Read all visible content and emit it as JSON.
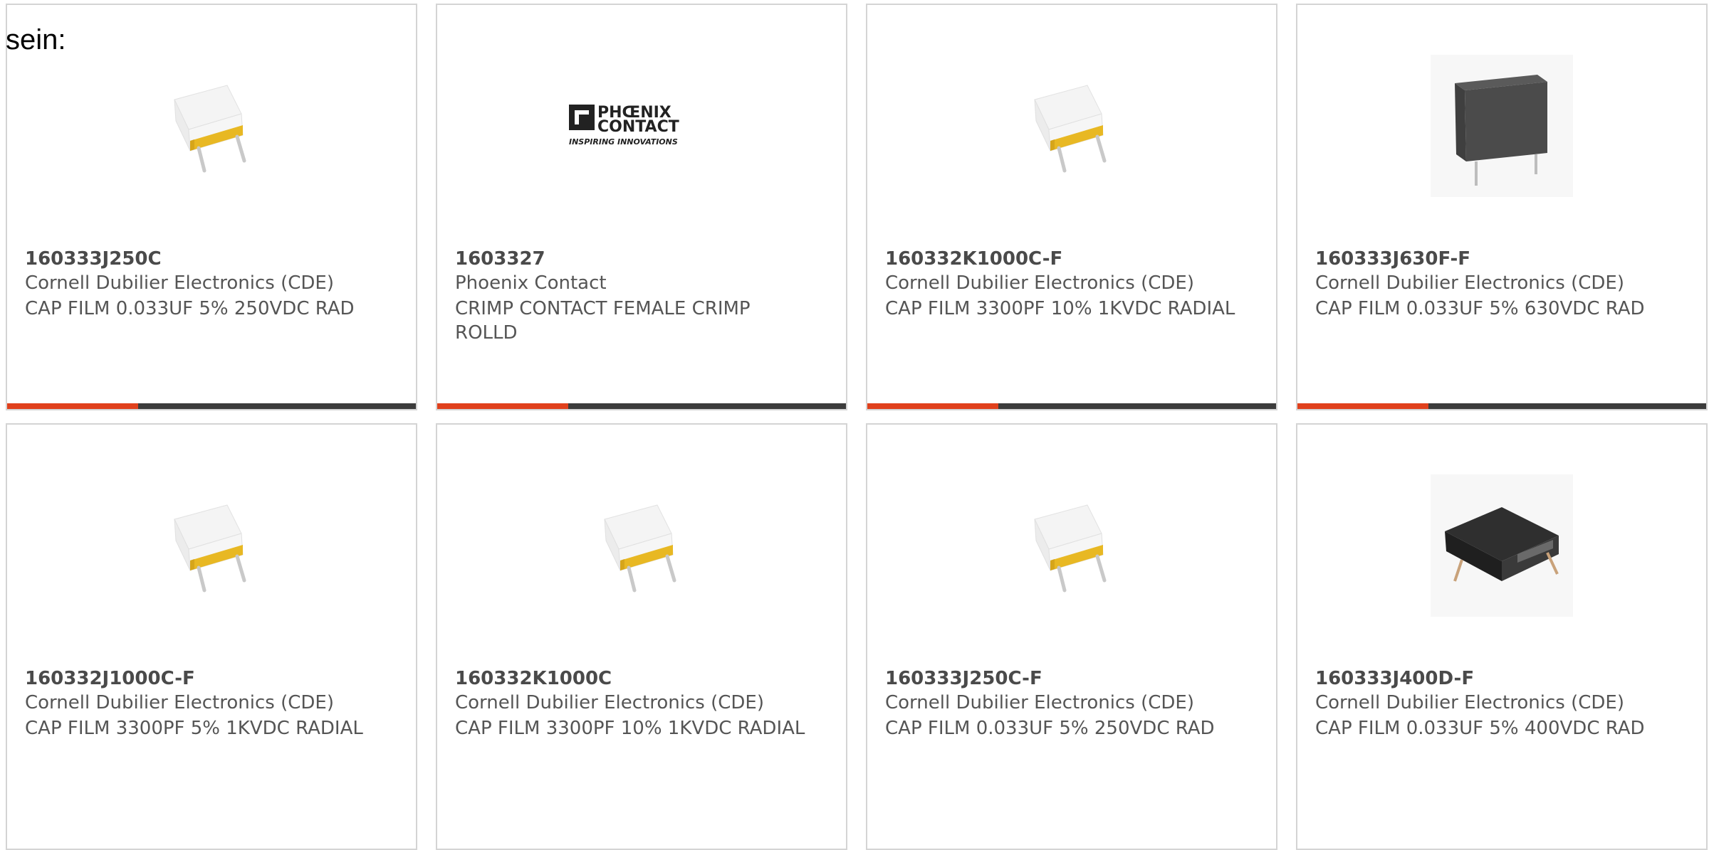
{
  "intro_text": "sein:",
  "accent_color": "#e0401c",
  "bar_color": "#3c3c3c",
  "products": [
    {
      "part": "160333J250C",
      "manufacturer": "Cornell Dubilier Electronics (CDE)",
      "description": "CAP FILM 0.033UF 5% 250VDC RAD",
      "image": "white-film-capacitor"
    },
    {
      "part": "1603327",
      "manufacturer": "Phoenix Contact",
      "description": "CRIMP CONTACT FEMALE CRIMP ROLLD",
      "image": "phoenix-contact-logo",
      "logo_line1": "PHŒNIX",
      "logo_line2": "CONTACT",
      "logo_tagline": "INSPIRING INNOVATIONS"
    },
    {
      "part": "160332K1000C-F",
      "manufacturer": "Cornell Dubilier Electronics (CDE)",
      "description": "CAP FILM 3300PF 10% 1KVDC RADIAL",
      "image": "white-film-capacitor"
    },
    {
      "part": "160333J630F-F",
      "manufacturer": "Cornell Dubilier Electronics (CDE)",
      "description": "CAP FILM 0.033UF 5% 630VDC RAD",
      "image": "black-box-capacitor"
    },
    {
      "part": "160332J1000C-F",
      "manufacturer": "Cornell Dubilier Electronics (CDE)",
      "description": "CAP FILM 3300PF 5% 1KVDC RADIAL",
      "image": "white-film-capacitor"
    },
    {
      "part": "160332K1000C",
      "manufacturer": "Cornell Dubilier Electronics (CDE)",
      "description": "CAP FILM 3300PF 10% 1KVDC RADIAL",
      "image": "white-film-capacitor"
    },
    {
      "part": "160333J250C-F",
      "manufacturer": "Cornell Dubilier Electronics (CDE)",
      "description": "CAP FILM 0.033UF 5% 250VDC RAD",
      "image": "white-film-capacitor"
    },
    {
      "part": "160333J400D-F",
      "manufacturer": "Cornell Dubilier Electronics (CDE)",
      "description": "CAP FILM 0.033UF 5% 400VDC RAD",
      "image": "dark-flat-capacitor"
    }
  ]
}
